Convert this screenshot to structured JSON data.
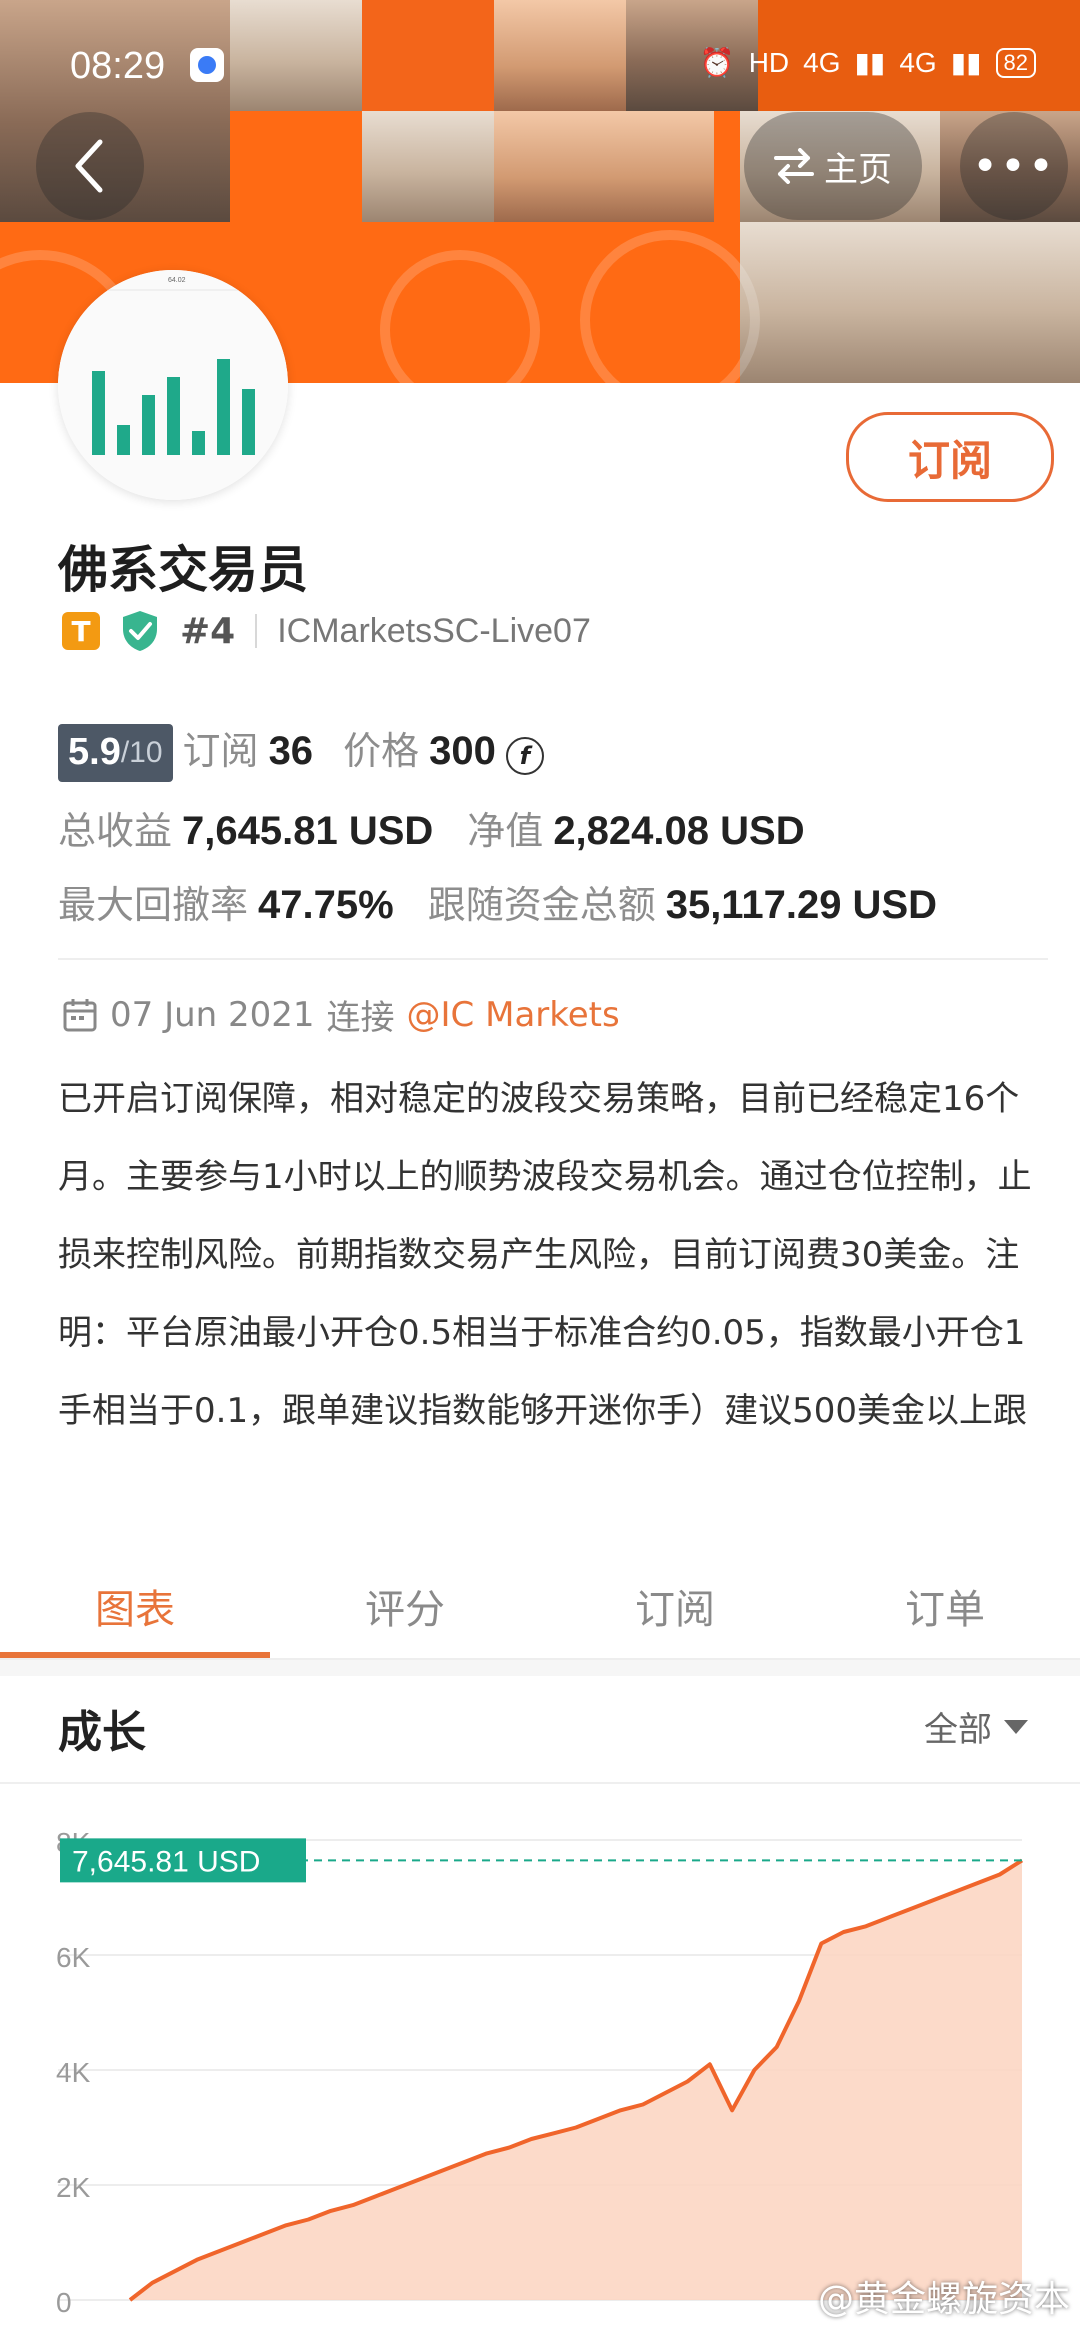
{
  "status_bar": {
    "time": "08:29",
    "hd": "HD",
    "network1": "4G",
    "network2": "4G",
    "battery": "82"
  },
  "header": {
    "home_label": "主页",
    "more_label": "•••"
  },
  "avatar_chart": {
    "label": "64.02",
    "values": [
      70,
      25,
      50,
      65,
      20,
      80,
      55
    ]
  },
  "profile": {
    "subscribe_label": "订阅",
    "name": "佛系交易员",
    "badge_letter": "T",
    "rank": "#4",
    "broker": "ICMarketsSC-Live07"
  },
  "stats": {
    "score": "5.9",
    "score_max": "/10",
    "subs_label": "订阅",
    "subs_value": "36",
    "price_label": "价格",
    "price_value": "300",
    "price_icon": "f",
    "total_profit_label": "总收益",
    "total_profit_value": "7,645.81 USD",
    "net_value_label": "净值",
    "net_value_value": "2,824.08 USD",
    "max_dd_label": "最大回撤率",
    "max_dd_value": "47.75%",
    "follow_label": "跟随资金总额",
    "follow_value": "35,117.29 USD"
  },
  "info": {
    "date": "07 Jun 2021",
    "connect_label": "连接",
    "connect_link": "@IC Markets",
    "description": "已开启订阅保障，相对稳定的波段交易策略，目前已经稳定16个月。主要参与1小时以上的顺势波段交易机会。通过仓位控制，止损来控制风险。前期指数交易产生风险，目前订阅费30美金。注明：平台原油最小开仓0.5相当于标准合约0.05，指数最小开仓1手相当于0.1，跟单建议指数能够开迷你手）建议500美金以上跟"
  },
  "tabs": [
    "图表",
    "评分",
    "订阅",
    "订单"
  ],
  "growth": {
    "title": "成长",
    "filter": "全部"
  },
  "chart_data": {
    "type": "area",
    "current_label": "7,645.81 USD",
    "y_ticks": [
      "0",
      "2K",
      "4K",
      "6K",
      "8K"
    ],
    "ylim": [
      0,
      8000
    ],
    "color": "#f0652b",
    "fill": "#fbd3c0",
    "label_color": "#1aa98a",
    "values": [
      0,
      300,
      500,
      700,
      850,
      1000,
      1150,
      1300,
      1400,
      1550,
      1650,
      1800,
      1950,
      2100,
      2250,
      2400,
      2550,
      2650,
      2800,
      2900,
      3000,
      3150,
      3300,
      3400,
      3600,
      3800,
      4100,
      3300,
      4000,
      4400,
      5200,
      6200,
      6400,
      6500,
      6650,
      6800,
      6950,
      7100,
      7250,
      7400,
      7645.81
    ]
  },
  "watermark": "@黄金螺旋资本"
}
